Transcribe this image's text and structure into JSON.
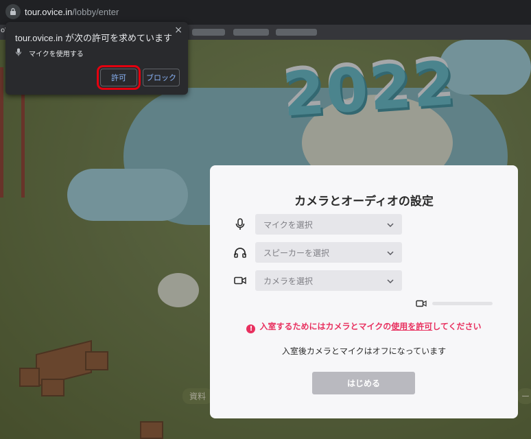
{
  "browser": {
    "url_host": "tour.ovice.in",
    "url_path": "/lobby/enter",
    "tab_fragment": "o\\"
  },
  "permission_popup": {
    "title": "tour.ovice.in が次の許可を求めています",
    "permission_label": "マイクを使用する",
    "allow_label": "許可",
    "block_label": "ブロック",
    "close_glyph": "×"
  },
  "scene": {
    "banner_text": "2022",
    "sign_left": "資料",
    "sign_right": "ー"
  },
  "dialog": {
    "title": "カメラとオーディオの設定",
    "mic_placeholder": "マイクを選択",
    "speaker_placeholder": "スピーカーを選択",
    "camera_placeholder": "カメラを選択",
    "warning_prefix": "入室するためにはカメラとマイクの",
    "warning_link": "使用を許可",
    "warning_suffix": "してください",
    "note": "入室後カメラとマイクはオフになっています",
    "start_label": "はじめる",
    "chevron": "⌄"
  },
  "colors": {
    "warning": "#e8305f",
    "highlight": "#e3000f",
    "link_blue": "#8ab4f8"
  }
}
